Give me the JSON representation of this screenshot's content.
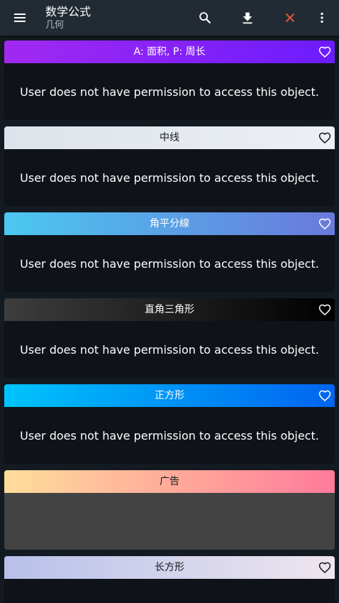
{
  "appbar": {
    "title": "数学公式",
    "subtitle": "几何",
    "icons": [
      "menu-icon",
      "search-icon",
      "download-icon",
      "close-icon",
      "more-vert-icon"
    ],
    "close_color": "#e5533c"
  },
  "cards": [
    {
      "title": "A: 面积, P: 周长",
      "message": "User does not have permission to access this object.",
      "gradient": [
        "#a129f0",
        "#6c1cff"
      ],
      "title_color": "#ffffff",
      "favorite": "heart-outline-icon"
    },
    {
      "title": "中线",
      "message": "User does not have permission to access this object.",
      "gradient": [
        "#dde3ea",
        "#ecf0f4"
      ],
      "title_color": "#15191e",
      "favorite": "heart-outline-icon"
    },
    {
      "title": "角平分線",
      "message": "User does not have permission to access this object.",
      "gradient": [
        "#4bc8f1",
        "#6a79db"
      ],
      "title_color": "#ffffff",
      "favorite": "heart-outline-icon"
    },
    {
      "title": "直角三角形",
      "message": "User does not have permission to access this object.",
      "gradient": [
        "#3d3d3d",
        "#000000"
      ],
      "title_color": "#ffffff",
      "favorite": "heart-outline-icon"
    },
    {
      "title": "正方形",
      "message": "User does not have permission to access this object.",
      "gradient": [
        "#00c4fb",
        "#0064f0"
      ],
      "title_color": "#ffffff",
      "favorite": "heart-outline-icon"
    }
  ],
  "ad": {
    "title": "广告",
    "gradient": [
      "#ffdd9b",
      "#ff7a9a"
    ],
    "title_color": "#15191e"
  },
  "last_card": {
    "title": "长方形",
    "gradient": [
      "#b8c0ea",
      "#eee6ee"
    ],
    "title_color": "#15191e",
    "favorite": "heart-outline-icon"
  }
}
